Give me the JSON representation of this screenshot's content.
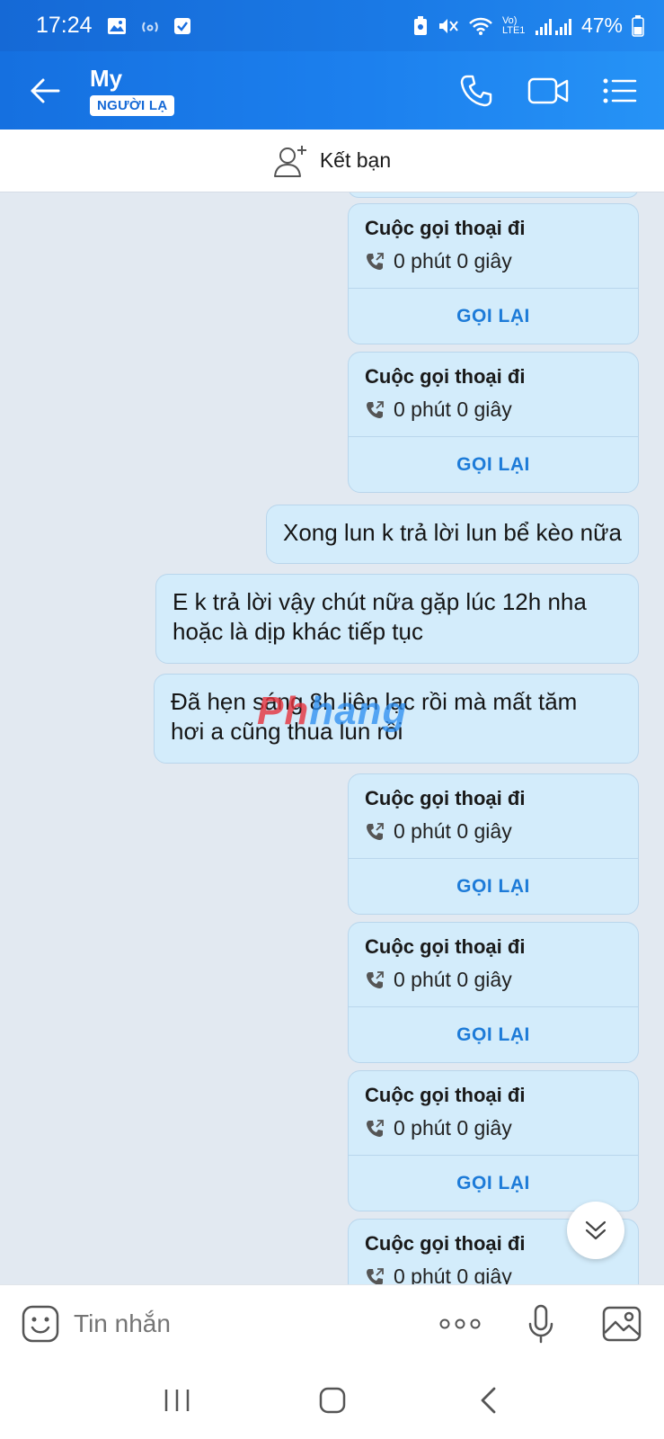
{
  "status": {
    "time": "17:24",
    "network": "Vo) LTE1",
    "battery": "47%"
  },
  "header": {
    "name": "My",
    "badge": "NGƯỜI LẠ"
  },
  "friend_bar": {
    "label": "Kết bạn"
  },
  "messages": {
    "call1": {
      "title": "Cuộc gọi thoại đi",
      "duration": "0 phút 0 giây",
      "action": "GỌI LẠI"
    },
    "call2": {
      "title": "Cuộc gọi thoại đi",
      "duration": "0 phút 0 giây",
      "action": "GỌI LẠI"
    },
    "text1": "Xong lun k trả lời lun bể kèo nữa",
    "text2_line1": "E k trả lời vậy chút nữa gặp lúc 12h nha",
    "text2_line2": "hoặc là dịp khác tiếp tục",
    "text3_line1": "Đã hẹn sáng 8h liên lạc rồi mà mất tăm",
    "text3_line2": "hơi a cũng thua lun rồi",
    "call3": {
      "title": "Cuộc gọi thoại đi",
      "duration": "0 phút 0 giây",
      "action": "GỌI LẠI"
    },
    "call4": {
      "title": "Cuộc gọi thoại đi",
      "duration": "0 phút 0 giây",
      "action": "GỌI LẠI"
    },
    "call5": {
      "title": "Cuộc gọi thoại đi",
      "duration": "0 phút 0 giây",
      "action": "GỌI LẠI"
    },
    "call6": {
      "title": "Cuộc gọi thoại đi",
      "duration": "0 phút 0 giây"
    }
  },
  "watermark": {
    "part_a": "Ph",
    "part_b": "hang"
  },
  "composer": {
    "placeholder": "Tin nhắn"
  },
  "colors": {
    "header_blue": "#1a7ae6",
    "bubble": "#d3ecfb",
    "action_blue": "#1d7bd8",
    "background": "#e2e9f1"
  }
}
